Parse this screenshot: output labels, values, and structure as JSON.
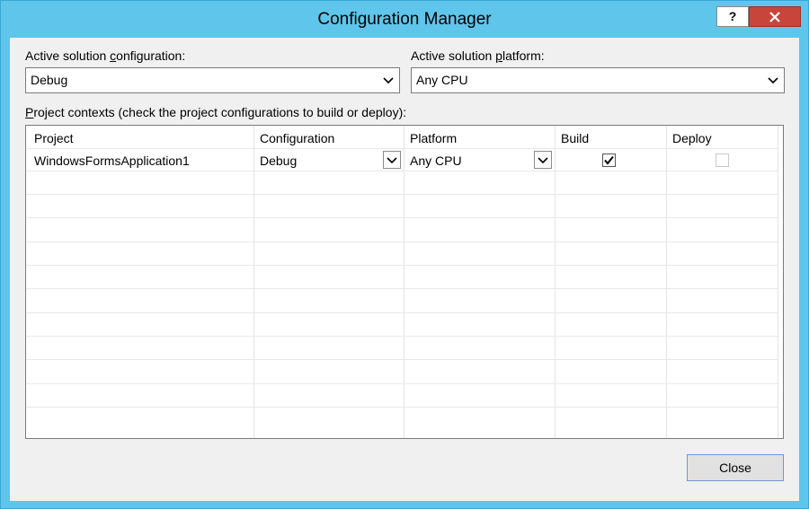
{
  "window": {
    "title": "Configuration Manager",
    "help_label": "?",
    "close_label": "X"
  },
  "active_config": {
    "label_pre": "Active solution ",
    "label_accel": "c",
    "label_post": "onfiguration:",
    "value": "Debug"
  },
  "active_platform": {
    "label_pre": "Active solution ",
    "label_accel": "p",
    "label_post": "latform:",
    "value": "Any CPU"
  },
  "contexts": {
    "label_accel": "P",
    "label_post": "roject contexts (check the project configurations to build or deploy):"
  },
  "grid": {
    "columns": [
      "Project",
      "Configuration",
      "Platform",
      "Build",
      "Deploy"
    ],
    "rows": [
      {
        "project": "WindowsFormsApplication1",
        "configuration": "Debug",
        "platform": "Any CPU",
        "build": true,
        "deploy": false
      }
    ]
  },
  "footer": {
    "close_label": "Close"
  },
  "colors": {
    "titlebar": "#5fc5ea",
    "close_button": "#c8453b"
  }
}
